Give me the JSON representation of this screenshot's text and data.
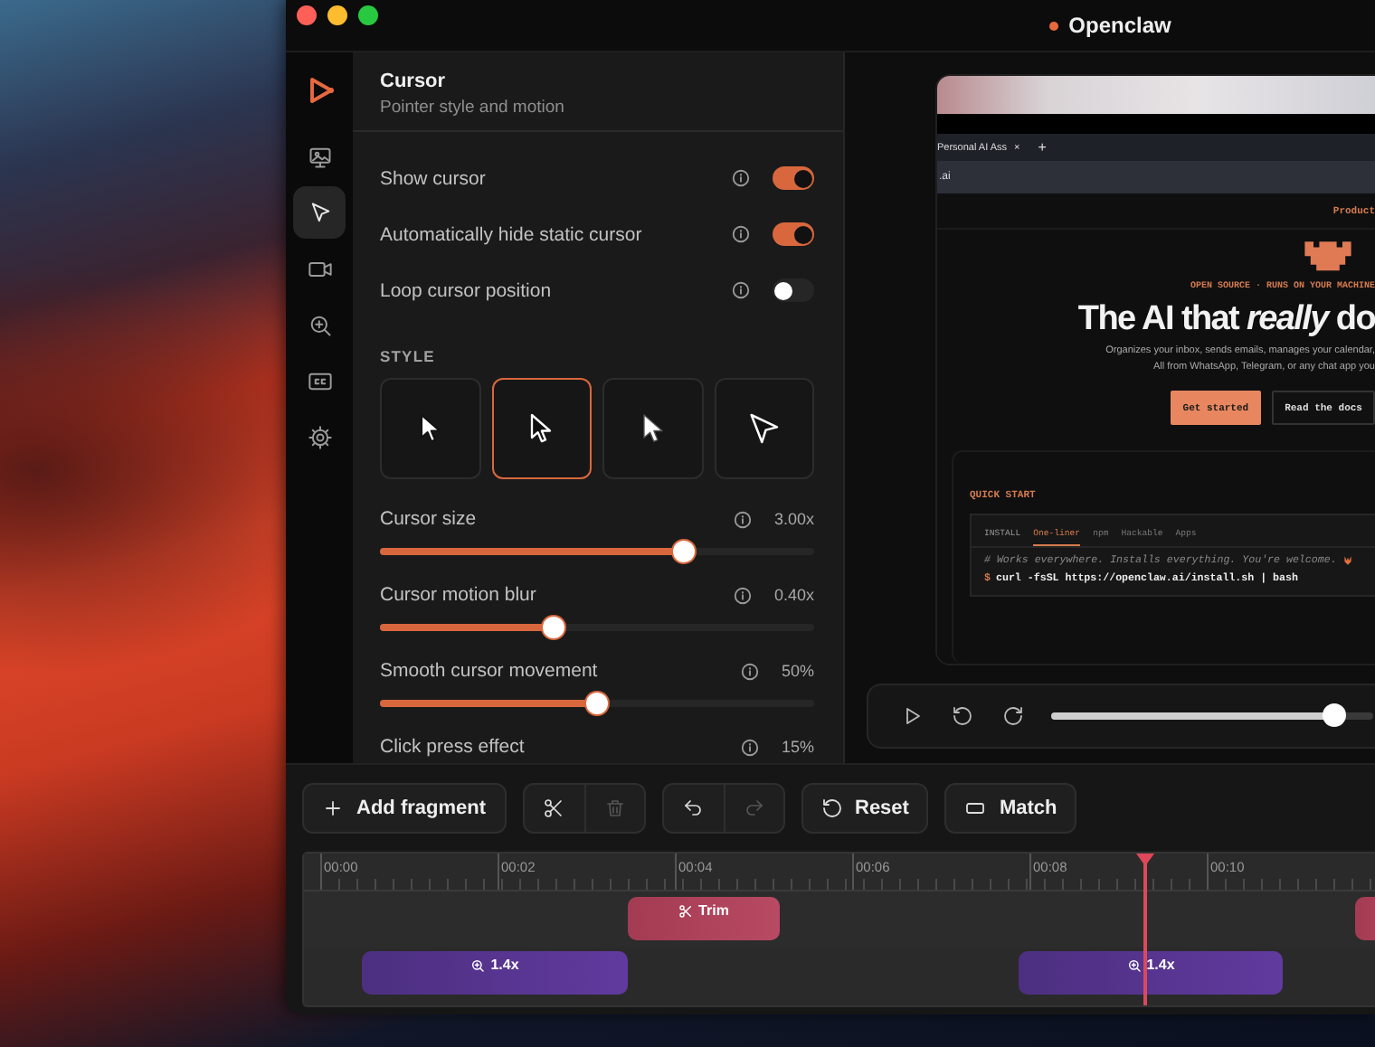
{
  "window": {
    "title": "Openclaw"
  },
  "sidebar": {
    "items": [
      {
        "kind": "screen",
        "selected": false
      },
      {
        "kind": "cursor",
        "selected": true
      },
      {
        "kind": "camera",
        "selected": false
      },
      {
        "kind": "zoom",
        "selected": false
      },
      {
        "kind": "captions",
        "selected": false
      },
      {
        "kind": "settings",
        "selected": false
      }
    ]
  },
  "panel": {
    "title": "Cursor",
    "subtitle": "Pointer style and motion",
    "toggles": [
      {
        "label": "Show cursor",
        "on": true
      },
      {
        "label": "Automatically hide static cursor",
        "on": true
      },
      {
        "label": "Loop cursor position",
        "on": false
      }
    ],
    "style_heading": "STYLE",
    "styles": [
      {
        "kind": "classic",
        "selected": false
      },
      {
        "kind": "outline",
        "selected": true
      },
      {
        "kind": "solid",
        "selected": false
      },
      {
        "kind": "pointer",
        "selected": false
      }
    ],
    "sliders": [
      {
        "label": "Cursor size",
        "reading": "3.00x",
        "level": 0.7
      },
      {
        "label": "Cursor motion blur",
        "reading": "0.40x",
        "level": 0.4
      },
      {
        "label": "Smooth cursor movement",
        "reading": "50%",
        "level": 0.5
      },
      {
        "label": "Click press effect",
        "reading": "15%"
      }
    ]
  },
  "preview": {
    "browser": {
      "tab": "Personal AI Ass",
      "tab_close": "×",
      "new_tab": "+",
      "address": ".ai"
    },
    "site": {
      "nav_link": "Product",
      "eyebrow": "OPEN SOURCE · RUNS ON YOUR MACHINE",
      "headline": "The AI that *really* do",
      "description": [
        "Organizes your inbox, sends emails, manages your calendar,",
        "All from WhatsApp, Telegram, or any chat app you"
      ],
      "buttons": [
        {
          "label": "Get started",
          "kind": "primary"
        },
        {
          "label": "Read the docs",
          "kind": "secondary"
        }
      ],
      "quick_start": {
        "title": "QUICK START",
        "label": "INSTALL",
        "tabs": [
          {
            "label": "One-liner",
            "selected": true
          },
          {
            "label": "npm",
            "selected": false
          },
          {
            "label": "Hackable",
            "selected": false
          },
          {
            "label": "Apps",
            "selected": false
          }
        ],
        "comment": "# Works everywhere. Installs everything. You're welcome.",
        "prompt": "$",
        "command": "curl -fsSL https://openclaw.ai/install.sh | bash"
      }
    },
    "player": {
      "level": 0.875
    }
  },
  "toolbar": {
    "add": "Add fragment",
    "edit": [
      {
        "kind": "cut",
        "disabled": false
      },
      {
        "kind": "delete",
        "disabled": true
      }
    ],
    "history": [
      {
        "kind": "undo",
        "disabled": false
      },
      {
        "kind": "redo",
        "disabled": true
      }
    ],
    "reset": "Reset",
    "match": "Match"
  },
  "timeline": {
    "ruler": [
      "00:00",
      "00:02",
      "00:04",
      "00:06",
      "00:08",
      "00:10"
    ],
    "playhead": {
      "level": 0.786
    },
    "tracks": [
      {
        "clips": [
          {
            "kind": "trim",
            "label": "Trim"
          },
          {
            "kind": "trim"
          }
        ]
      },
      {
        "clips": [
          {
            "kind": "zoom",
            "label": "1.4x"
          },
          {
            "kind": "zoom",
            "label": "1.4x"
          }
        ]
      }
    ]
  }
}
